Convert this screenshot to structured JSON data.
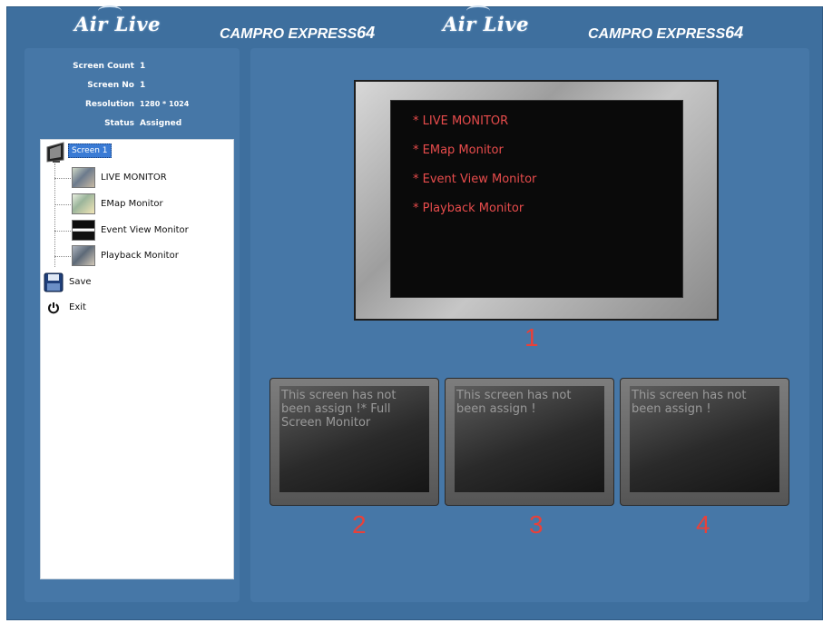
{
  "header": {
    "brands": [
      {
        "airlive": "Air Live",
        "campro": "CAMPRO EXPRESS",
        "campro_num": "64"
      },
      {
        "airlive": "Air Live",
        "campro": "CAMPRO EXPRESS",
        "campro_num": "64"
      }
    ]
  },
  "info": {
    "screen_count_label": "Screen Count",
    "screen_count_value": "1",
    "screen_no_label": "Screen No",
    "screen_no_value": "1",
    "resolution_label": "Resolution",
    "resolution_value": "1280 * 1024",
    "status_label": "Status",
    "status_value": "Assigned"
  },
  "tree": {
    "screen_label": "Screen 1",
    "items": [
      {
        "label": "LIVE MONITOR",
        "icon": "live-monitor-thumbnail"
      },
      {
        "label": "EMap Monitor",
        "icon": "emap-monitor-thumbnail"
      },
      {
        "label": "Event View Monitor",
        "icon": "event-view-monitor-thumbnail"
      },
      {
        "label": "Playback Monitor",
        "icon": "playback-monitor-thumbnail"
      }
    ],
    "save_label": "Save",
    "exit_label": "Exit"
  },
  "main_monitor": {
    "number": "1",
    "lines": [
      "* LIVE MONITOR",
      "* EMap Monitor",
      "* Event View Monitor",
      "* Playback Monitor"
    ]
  },
  "small_monitors": [
    {
      "number": "2",
      "text": "This screen has not been assign !* Full Screen Monitor"
    },
    {
      "number": "3",
      "text": "This screen has not been assign !"
    },
    {
      "number": "4",
      "text": "This screen has not been assign !"
    }
  ],
  "colors": {
    "background": "#3e6f9e",
    "panel": "#4677a7",
    "accent_red": "#e8413a",
    "selection": "#3a7bd5"
  }
}
